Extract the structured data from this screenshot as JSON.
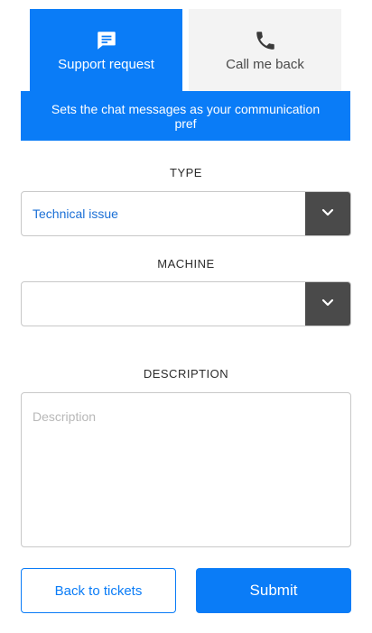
{
  "tabs": [
    {
      "label": "Support request",
      "icon": "chat-message-icon",
      "active": true
    },
    {
      "label": "Call me back",
      "icon": "phone-icon",
      "active": false
    }
  ],
  "banner": {
    "text": "Sets the chat messages as your communication pref"
  },
  "form": {
    "type": {
      "label": "TYPE",
      "value": "Technical issue",
      "icon": "chevron-down-icon"
    },
    "machine": {
      "label": "MACHINE",
      "value": "",
      "icon": "chevron-down-icon"
    },
    "description": {
      "label": "DESCRIPTION",
      "placeholder": "Description",
      "value": ""
    }
  },
  "actions": {
    "back_label": "Back to tickets",
    "submit_label": "Submit"
  },
  "colors": {
    "accent": "#0a7cf7",
    "tab_inactive_bg": "#f3f3f3",
    "dropdown_button_bg": "#4a4a4a"
  }
}
